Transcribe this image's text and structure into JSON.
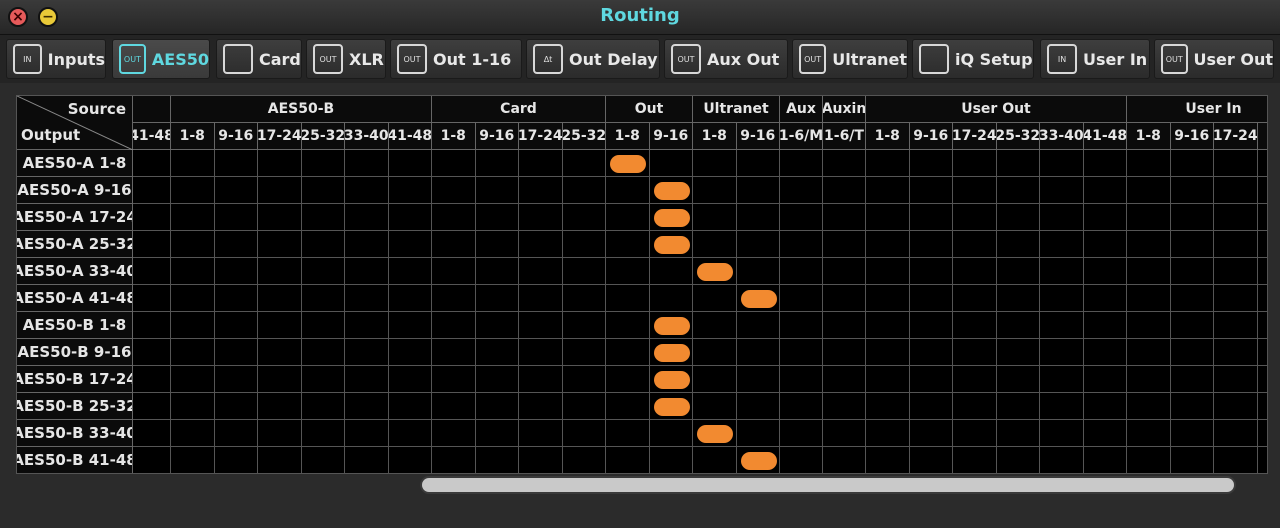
{
  "window": {
    "title": "Routing"
  },
  "tabs": [
    {
      "label": "Inputs",
      "icon": "in-icon",
      "icon_text": "IN",
      "active": false
    },
    {
      "label": "AES50",
      "icon": "out-icon",
      "icon_text": "OUT",
      "active": true
    },
    {
      "label": "Card",
      "icon": "card-icon",
      "icon_text": "",
      "active": false
    },
    {
      "label": "XLR",
      "icon": "xlr-icon",
      "icon_text": "OUT",
      "active": false
    },
    {
      "label": "Out 1-16",
      "icon": "out-icon",
      "icon_text": "OUT",
      "active": false
    },
    {
      "label": "Out Delay",
      "icon": "delay-icon",
      "icon_text": "Δt",
      "active": false
    },
    {
      "label": "Aux Out",
      "icon": "out-icon",
      "icon_text": "OUT",
      "active": false
    },
    {
      "label": "Ultranet",
      "icon": "out-icon",
      "icon_text": "OUT",
      "active": false
    },
    {
      "label": "iQ Setup",
      "icon": "speaker-icon",
      "icon_text": "",
      "active": false
    },
    {
      "label": "User In",
      "icon": "in-icon",
      "icon_text": "IN",
      "active": false
    },
    {
      "label": "User Out",
      "icon": "out-icon",
      "icon_text": "OUT",
      "active": false
    }
  ],
  "matrix": {
    "corner_source": "Source",
    "corner_output": "Output",
    "first_col_partial": "41-48",
    "groups": [
      {
        "label": "AES50-B",
        "cols": [
          "1-8",
          "9-16",
          "17-24",
          "25-32",
          "33-40",
          "41-48"
        ]
      },
      {
        "label": "Card",
        "cols": [
          "1-8",
          "9-16",
          "17-24",
          "25-32"
        ]
      },
      {
        "label": "Out",
        "cols": [
          "1-8",
          "9-16"
        ]
      },
      {
        "label": "Ultranet",
        "cols": [
          "1-8",
          "9-16"
        ]
      },
      {
        "label": "Aux",
        "cols": [
          "1-6/M"
        ]
      },
      {
        "label": "Auxin",
        "cols": [
          "1-6/T"
        ]
      },
      {
        "label": "User Out",
        "cols": [
          "1-8",
          "9-16",
          "17-24",
          "25-32",
          "33-40",
          "41-48"
        ]
      },
      {
        "label": "User In",
        "cols": [
          "1-8",
          "9-16",
          "17-24",
          "2"
        ]
      }
    ],
    "rows": [
      {
        "label": "AES50-A 1-8",
        "active": "Out 1-8"
      },
      {
        "label": "AES50-A 9-16",
        "active": "Out 9-16"
      },
      {
        "label": "AES50-A 17-24",
        "active": "Out 9-16"
      },
      {
        "label": "AES50-A 25-32",
        "active": "Out 9-16"
      },
      {
        "label": "AES50-A 33-40",
        "active": "Ultranet 1-8"
      },
      {
        "label": "AES50-A 41-48",
        "active": "Ultranet 9-16"
      },
      {
        "label": "AES50-B 1-8",
        "active": "Out 9-16"
      },
      {
        "label": "AES50-B 9-16",
        "active": "Out 9-16"
      },
      {
        "label": "AES50-B 17-24",
        "active": "Out 9-16"
      },
      {
        "label": "AES50-B 25-32",
        "active": "Out 9-16"
      },
      {
        "label": "AES50-B 33-40",
        "active": "Ultranet 1-8"
      },
      {
        "label": "AES50-B 41-48",
        "active": "Ultranet 9-16"
      }
    ],
    "accent_color": "#f28a30",
    "title_color": "#5fd8e0"
  }
}
